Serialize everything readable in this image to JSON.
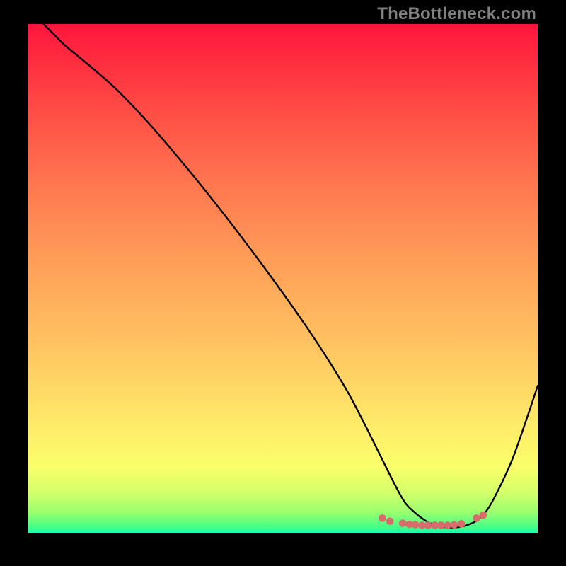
{
  "watermark": "TheBottleneck.com",
  "colors": {
    "page_bg": "#000000",
    "curve_stroke": "#000000",
    "dot_fill": "#d86b6b",
    "watermark_color": "#808080"
  },
  "chart_data": {
    "type": "line",
    "title": "",
    "xlabel": "",
    "ylabel": "",
    "xlim": [
      0,
      100
    ],
    "ylim": [
      0,
      100
    ],
    "grid": false,
    "legend": false,
    "series": [
      {
        "name": "curve",
        "x": [
          3,
          5,
          7,
          10,
          13,
          18,
          25,
          35,
          45,
          55,
          62,
          66,
          69,
          72,
          74,
          76,
          78,
          80,
          82,
          84,
          86,
          88,
          90,
          92,
          95,
          98,
          100
        ],
        "y": [
          100,
          98,
          96,
          93.5,
          91,
          86.5,
          79,
          67,
          54,
          40,
          29,
          21.5,
          15.5,
          9.5,
          6,
          4,
          2.5,
          1.6,
          1.2,
          1.2,
          1.6,
          2.5,
          4.5,
          8,
          14.5,
          23,
          29
        ]
      }
    ],
    "marker_points": {
      "name": "red-dots",
      "x": [
        69.5,
        71.0,
        73.5,
        74.8,
        76.0,
        77.3,
        78.5,
        79.8,
        81.0,
        82.3,
        83.6,
        85.0,
        88.0,
        89.3
      ],
      "y": [
        3.0,
        2.4,
        2.0,
        1.8,
        1.7,
        1.6,
        1.6,
        1.6,
        1.6,
        1.6,
        1.7,
        1.9,
        3.0,
        3.6
      ]
    }
  }
}
